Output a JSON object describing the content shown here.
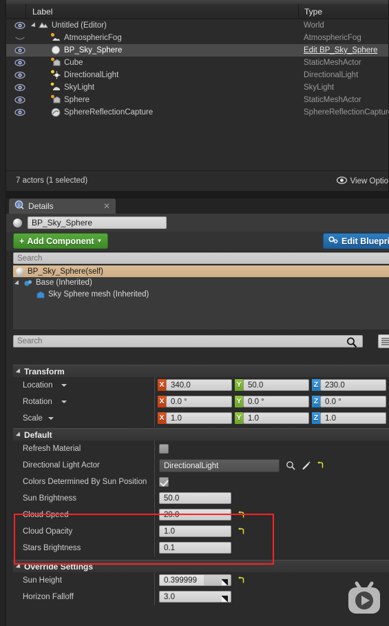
{
  "outliner": {
    "columns": {
      "label": "Label",
      "type": "Type"
    },
    "rows": [
      {
        "label": "Untitled (Editor)",
        "type": "World",
        "icon": "world-icon",
        "indent": 22,
        "expandable": true,
        "visible": true,
        "selected": false
      },
      {
        "label": "AtmosphericFog",
        "type": "AtmosphericFog",
        "icon": "fog-icon",
        "indent": 40,
        "expandable": false,
        "visible": false,
        "selected": false
      },
      {
        "label": "BP_Sky_Sphere",
        "type": "Edit BP_Sky_Sphere",
        "icon": "sphere-icon",
        "indent": 40,
        "expandable": false,
        "visible": true,
        "selected": true
      },
      {
        "label": "Cube",
        "type": "StaticMeshActor",
        "icon": "mesh-icon",
        "indent": 40,
        "expandable": false,
        "visible": true,
        "selected": false
      },
      {
        "label": "DirectionalLight",
        "type": "DirectionalLight",
        "icon": "light-icon",
        "indent": 40,
        "expandable": false,
        "visible": true,
        "selected": false
      },
      {
        "label": "SkyLight",
        "type": "SkyLight",
        "icon": "skylight-icon",
        "indent": 40,
        "expandable": false,
        "visible": true,
        "selected": false
      },
      {
        "label": "Sphere",
        "type": "StaticMeshActor",
        "icon": "mesh-icon",
        "indent": 40,
        "expandable": false,
        "visible": true,
        "selected": false
      },
      {
        "label": "SphereReflectionCapture",
        "type": "SphereReflectionCapture",
        "icon": "reflection-icon",
        "indent": 40,
        "expandable": false,
        "visible": true,
        "selected": false
      }
    ],
    "footer": {
      "count": "7 actors (1 selected)",
      "view_options": "View Optio"
    }
  },
  "details": {
    "tab_title": "Details",
    "actor_name": "BP_Sky_Sphere",
    "add_component_label": "Add Component",
    "edit_blueprint_label": "Edit Blueprin",
    "search_placeholder_top": "Search",
    "self_row": "BP_Sky_Sphere(self)",
    "components": [
      {
        "label": "Base (Inherited)",
        "indent": 14,
        "expandable": true,
        "icon": "base-component-icon"
      },
      {
        "label": "Sky Sphere mesh (Inherited)",
        "indent": 32,
        "expandable": false,
        "icon": "mesh-component-icon"
      }
    ],
    "search_placeholder_props": "Search",
    "sections": {
      "transform": {
        "title": "Transform",
        "rows": [
          {
            "label": "Location",
            "x": "340.0",
            "y": "50.0",
            "z": "230.0",
            "spinner": false
          },
          {
            "label": "Rotation",
            "x": "0.0 °",
            "y": "0.0 °",
            "z": "0.0 °",
            "spinner": true
          },
          {
            "label": "Scale",
            "x": "1.0",
            "y": "1.0",
            "z": "1.0",
            "spinner": false
          }
        ]
      },
      "default": {
        "title": "Default",
        "rows": [
          {
            "label": "Refresh Material",
            "kind": "checkbox",
            "checked": false,
            "reset": false
          },
          {
            "label": "Directional Light Actor",
            "kind": "combo",
            "value": "DirectionalLight",
            "reset": true
          },
          {
            "label": "Colors Determined By Sun Position",
            "kind": "checkbox",
            "checked": true,
            "reset": false
          },
          {
            "label": "Sun Brightness",
            "kind": "number",
            "value": "50.0",
            "reset": false
          },
          {
            "label": "Cloud Speed",
            "kind": "number",
            "value": "20.0",
            "reset": true
          },
          {
            "label": "Cloud Opacity",
            "kind": "number",
            "value": "1.0",
            "reset": true
          },
          {
            "label": "Stars Brightness",
            "kind": "number",
            "value": "0.1",
            "reset": false
          }
        ]
      },
      "override": {
        "title": "Override Settings",
        "rows": [
          {
            "label": "Sun Height",
            "kind": "slider",
            "value": "0.399999",
            "fill": 0.62,
            "reset": true
          },
          {
            "label": "Horizon Falloff",
            "kind": "number",
            "value": "3.0",
            "reset": false
          }
        ]
      }
    }
  },
  "colors": {
    "axis_x": "#e0551f",
    "axis_y": "#92c83e",
    "axis_z": "#3a9de8",
    "add_button": "#4a9a32",
    "edit_button": "#2673b4",
    "highlight": "#ff2222",
    "self_row": "#d5b68f"
  }
}
